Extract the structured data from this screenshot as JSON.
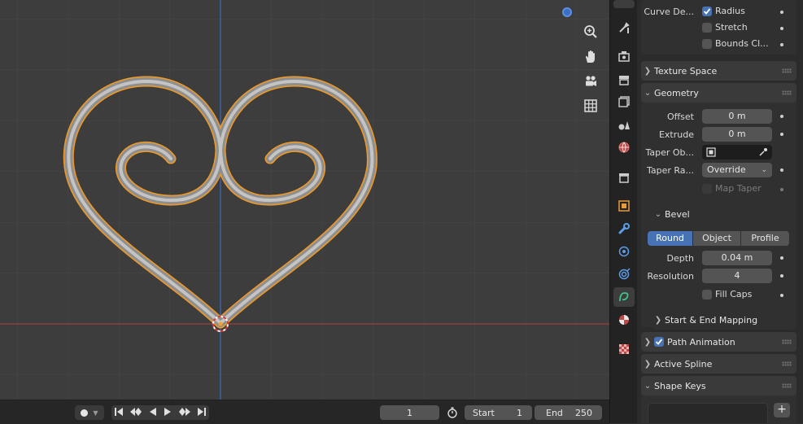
{
  "viewport": {
    "tools": [
      "zoom-icon",
      "hand-icon",
      "camera-icon",
      "grid-icon"
    ]
  },
  "timeline": {
    "current_frame": "1",
    "start_label": "Start",
    "start_value": "1",
    "end_label": "End",
    "end_value": "250"
  },
  "tabs": [
    "tool",
    "render",
    "output",
    "view-layer",
    "scene",
    "world",
    "collection",
    "object",
    "modifiers",
    "particles",
    "physics",
    "constraints",
    "data",
    "material",
    "texture"
  ],
  "props": {
    "curve_deform_label": "Curve De...",
    "radius_label": "Radius",
    "stretch_label": "Stretch",
    "bounds_label": "Bounds Cl...",
    "texture_space": "Texture Space",
    "geometry": "Geometry",
    "offset_label": "Offset",
    "offset_value": "0 m",
    "extrude_label": "Extrude",
    "extrude_value": "0 m",
    "taper_obj_label": "Taper Ob...",
    "taper_radius_label": "Taper Ra...",
    "taper_radius_value": "Override",
    "map_taper_label": "Map Taper",
    "bevel": "Bevel",
    "bevel_modes": [
      "Round",
      "Object",
      "Profile"
    ],
    "depth_label": "Depth",
    "depth_value": "0.04 m",
    "resolution_label": "Resolution",
    "resolution_value": "4",
    "fill_caps_label": "Fill Caps",
    "start_end_mapping": "Start & End Mapping",
    "path_animation": "Path Animation",
    "active_spline": "Active Spline",
    "shape_keys": "Shape Keys",
    "add_label": "+"
  },
  "colors": {
    "accent": "#4772b3",
    "selection": "#f5a02a",
    "x_axis": "#b84646",
    "y_axis": "#3c6bbd"
  }
}
